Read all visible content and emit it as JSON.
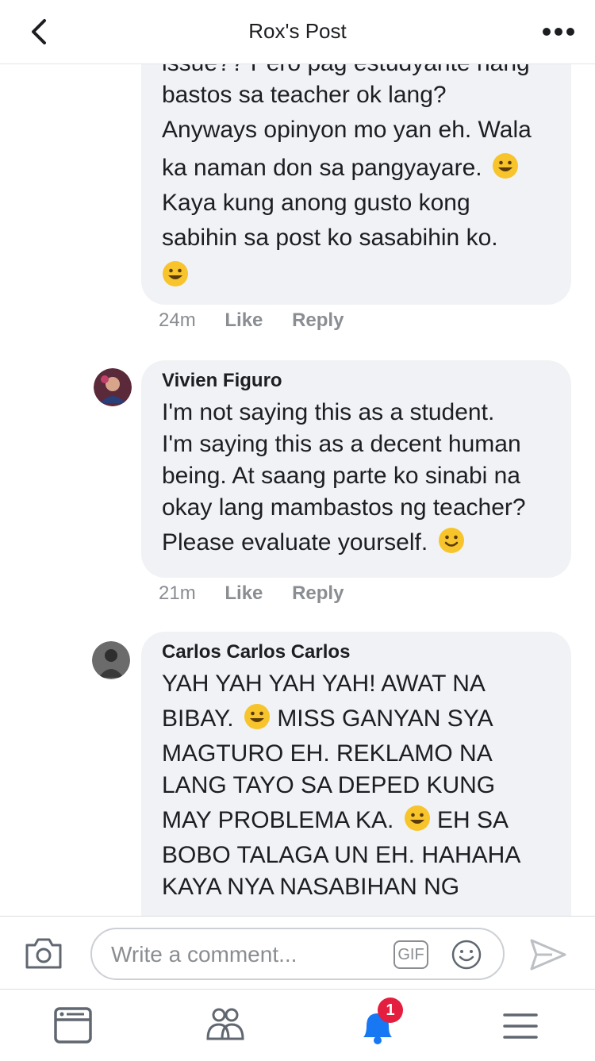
{
  "header": {
    "title": "Rox's Post"
  },
  "comments": [
    {
      "lines": [
        "issue?? Pero pag estudyante nang",
        "bastos sa teacher ok lang?",
        "Anyways opinyon mo yan eh. Wala",
        "ka naman don sa pangyayare.",
        "Kaya kung anong gusto kong",
        "sabihin sa post ko sasabihin ko."
      ],
      "time": "24m",
      "like": "Like",
      "reply": "Reply"
    },
    {
      "name": "Vivien Figuro",
      "lines": [
        "I'm not saying this as a student.",
        "I'm saying this as a decent human",
        "being. At saang parte ko sinabi na",
        "okay lang mambastos ng teacher?",
        "Please evaluate yourself."
      ],
      "time": "21m",
      "like": "Like",
      "reply": "Reply"
    },
    {
      "name": "Carlos Carlos Carlos",
      "lines": [
        "YAH YAH YAH YAH! AWAT NA",
        "BIBAY.",
        "MISS GANYAN SYA",
        "MAGTURO EH. REKLAMO NA",
        "LANG TAYO SA DEPED KUNG",
        "MAY PROBLEMA KA.",
        "EH SA",
        "BOBO TALAGA UN EH. HAHAHA",
        "KAYA NYA NASABIHAN NG"
      ]
    }
  ],
  "composer": {
    "placeholder": "Write a comment...",
    "gif_label": "GIF"
  },
  "nav": {
    "notifications_badge": "1"
  },
  "icons": {
    "back": "chevron-left-icon",
    "more": "more-horizontal-icon",
    "camera": "camera-icon",
    "emoji": "smiley-icon",
    "send": "send-icon",
    "feed": "news-feed-icon",
    "friends": "friends-icon",
    "notifications": "bell-icon",
    "menu": "hamburger-menu-icon"
  },
  "colors": {
    "bubble": "#f0f2f5",
    "badge": "#e41e3f",
    "bell": "#1877f2",
    "muted": "#8a8d91"
  }
}
